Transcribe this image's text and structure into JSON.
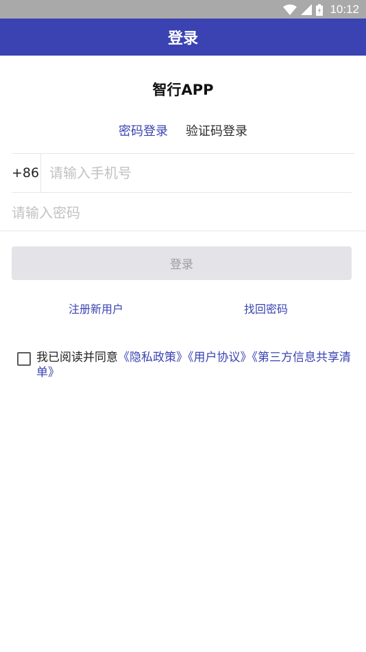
{
  "status_bar": {
    "time": "10:12",
    "icons": [
      "wifi-icon",
      "signal-icon",
      "battery-icon"
    ]
  },
  "app_bar": {
    "title": "登录"
  },
  "app_name": "智行APP",
  "login_tabs": [
    {
      "label": "密码登录",
      "active": true
    },
    {
      "label": "验证码登录",
      "active": false
    }
  ],
  "phone": {
    "country_code": "+86",
    "placeholder": "请输入手机号"
  },
  "password": {
    "placeholder": "请输入密码"
  },
  "login_button": {
    "label": "登录"
  },
  "links": {
    "register": "注册新用户",
    "forgot_password": "找回密码"
  },
  "agreement": {
    "checked": false,
    "prefix": "我已阅读并同意",
    "privacy_policy": "《隐私政策》",
    "user_agreement": "《用户协议》",
    "third_party_list": "《第三方信息共享清单》"
  },
  "colors": {
    "accent": "#3a43b1",
    "status_bar": "#a9a9a9",
    "button_disabled_bg": "#e3e3e8",
    "button_disabled_text": "#9e9e9e"
  }
}
